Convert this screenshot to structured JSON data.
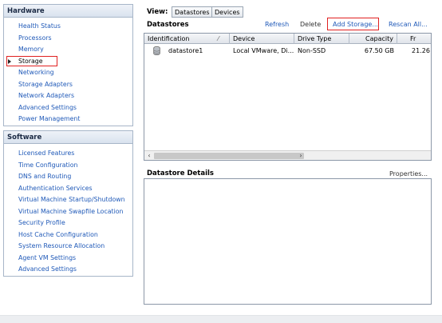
{
  "hardware": {
    "title": "Hardware",
    "items": [
      {
        "label": "Health Status"
      },
      {
        "label": "Processors"
      },
      {
        "label": "Memory"
      },
      {
        "label": "Storage"
      },
      {
        "label": "Networking"
      },
      {
        "label": "Storage Adapters"
      },
      {
        "label": "Network Adapters"
      },
      {
        "label": "Advanced Settings"
      },
      {
        "label": "Power Management"
      }
    ],
    "selected": "Storage"
  },
  "software": {
    "title": "Software",
    "items": [
      {
        "label": "Licensed Features"
      },
      {
        "label": "Time Configuration"
      },
      {
        "label": "DNS and Routing"
      },
      {
        "label": "Authentication Services"
      },
      {
        "label": "Virtual Machine Startup/Shutdown"
      },
      {
        "label": "Virtual Machine Swapfile Location"
      },
      {
        "label": "Security Profile"
      },
      {
        "label": "Host Cache Configuration"
      },
      {
        "label": "System Resource Allocation"
      },
      {
        "label": "Agent VM Settings"
      },
      {
        "label": "Advanced Settings"
      }
    ]
  },
  "view": {
    "label": "View:",
    "options": [
      "Datastores",
      "Devices"
    ],
    "selected": "Datastores"
  },
  "datastores": {
    "title": "Datastores",
    "toolbar": {
      "refresh": "Refresh",
      "delete": "Delete",
      "add_storage": "Add Storage...",
      "rescan": "Rescan All..."
    },
    "columns": [
      "Identification",
      "Device",
      "Drive Type",
      "Capacity",
      "Fr"
    ],
    "rows": [
      {
        "icon": "datastore-icon",
        "identification": "datastore1",
        "device": "Local VMware, Di...",
        "drive_type": "Non-SSD",
        "capacity": "67.50 GB",
        "free": "21.26"
      }
    ]
  },
  "details": {
    "title": "Datastore Details",
    "properties": "Properties..."
  },
  "colors": {
    "link": "#1f59b8",
    "highlight_border": "#e02020",
    "panel_border": "#a7b6c8"
  }
}
